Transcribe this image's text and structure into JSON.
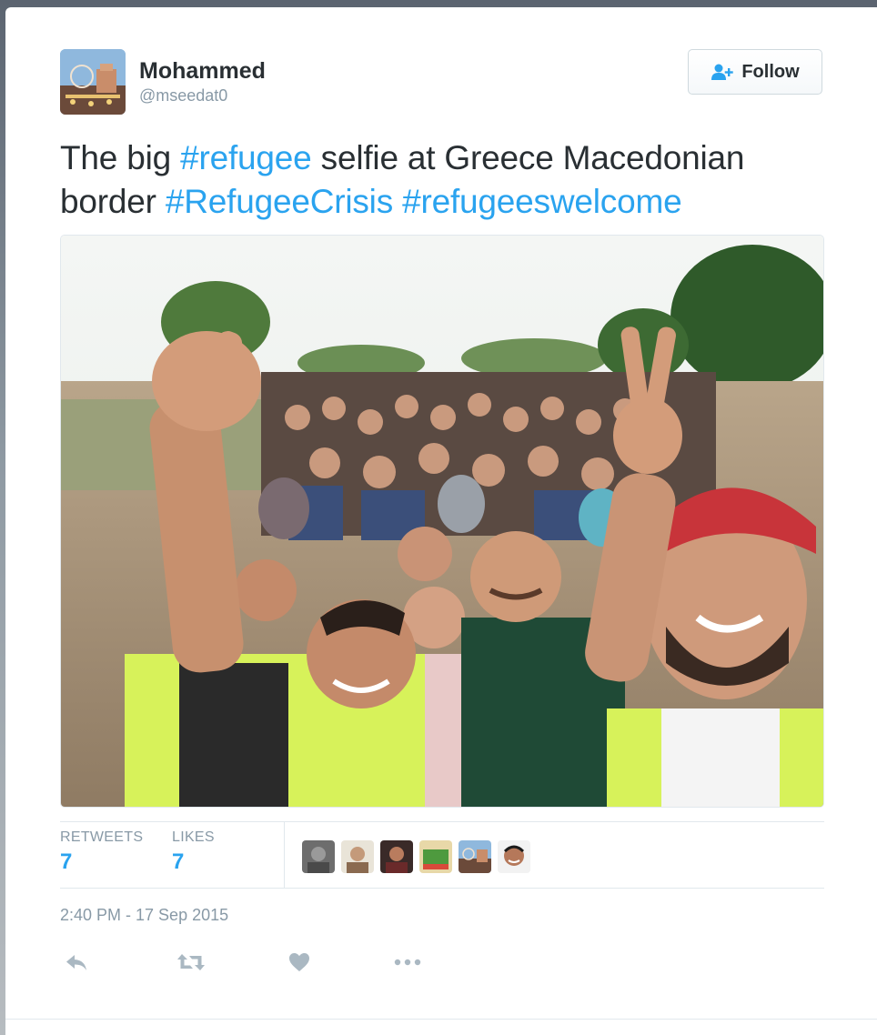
{
  "user": {
    "name": "Mohammed",
    "handle": "@mseedat0"
  },
  "follow_button": {
    "label": "Follow"
  },
  "tweet": {
    "text_parts": [
      {
        "text": "The big ",
        "hashtag": false
      },
      {
        "text": "#refugee",
        "hashtag": true
      },
      {
        "text": " selfie at Greece Macedonian border ",
        "hashtag": false
      },
      {
        "text": "#RefugeeCrisis",
        "hashtag": true
      },
      {
        "text": " ",
        "hashtag": false
      },
      {
        "text": "#refugeeswelcome",
        "hashtag": true
      }
    ]
  },
  "stats": {
    "retweets_label": "RETWEETS",
    "retweets_value": "7",
    "likes_label": "LIKES",
    "likes_value": "7"
  },
  "timestamp": "2:40 PM - 17 Sep 2015",
  "actions": [
    {
      "icon": "reply-icon"
    },
    {
      "icon": "retweet-icon"
    },
    {
      "icon": "heart-icon"
    },
    {
      "icon": "more-icon"
    }
  ],
  "colors": {
    "link": "#2aa3ef",
    "text": "#292f33",
    "muted": "#8899a6"
  }
}
